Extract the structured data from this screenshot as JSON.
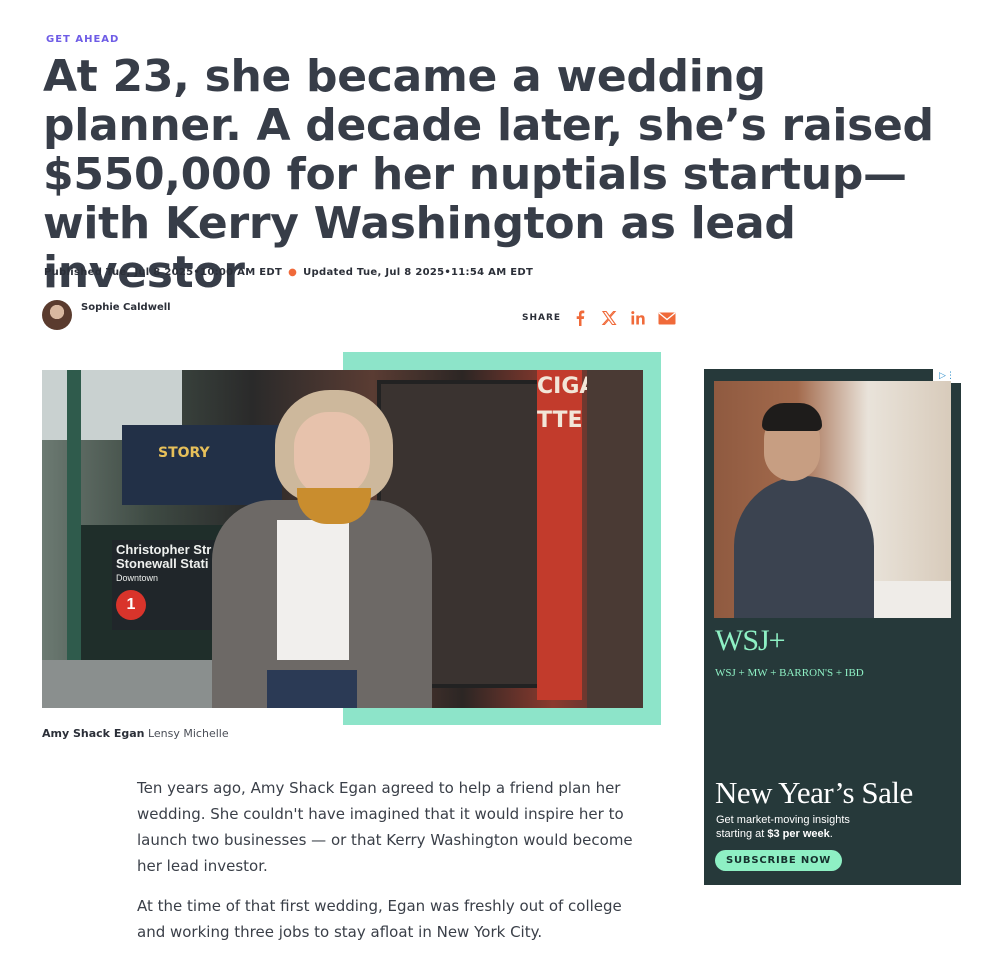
{
  "article": {
    "kicker": "GET AHEAD",
    "headline": "At 23, she became a wedding planner. A decade later, she’s raised $550,000 for her nuptials startup—with Kerry Washington as lead investor",
    "published": "Published Tue, Jul 8 2025•10:00 AM EDT",
    "updated": "Updated Tue, Jul 8 2025•11:54 AM EDT",
    "author": "Sophie Caldwell",
    "share_label": "SHARE",
    "share_icons": [
      "facebook-icon",
      "x-icon",
      "linkedin-icon",
      "email-icon"
    ],
    "accent_color": "#f06a3a",
    "caption_name": "Amy Shack Egan",
    "caption_credit": "Lensy Michelle",
    "paragraphs": [
      "Ten years ago, Amy Shack Egan agreed to help a friend plan her wedding. She couldn't have imagined that it would inspire her to launch two businesses — or that Kerry Washington would become her lead investor.",
      "At the time of that first wedding, Egan was freshly out of college and working three jobs to stay afloat in New York City."
    ]
  },
  "hero_photo": {
    "billboard_text": "STORY",
    "station_line1": "Christopher Str",
    "station_line2": "Stonewall Stati",
    "station_sub": "Downtown",
    "train_line": "1",
    "column_text": "CIGA TTE"
  },
  "ad": {
    "choices_label": "▷⋮",
    "logo": "WSJ+",
    "brands": "WSJ + MW + BARRON'S + IBD",
    "title": "New Year’s Sale",
    "subtitle_line1": "Get market-moving insights",
    "subtitle_prefix": "starting at ",
    "subtitle_price": "$3 per week",
    "subtitle_suffix": ".",
    "cta": "SUBSCRIBE NOW",
    "accent_color": "#8ef0c4"
  }
}
